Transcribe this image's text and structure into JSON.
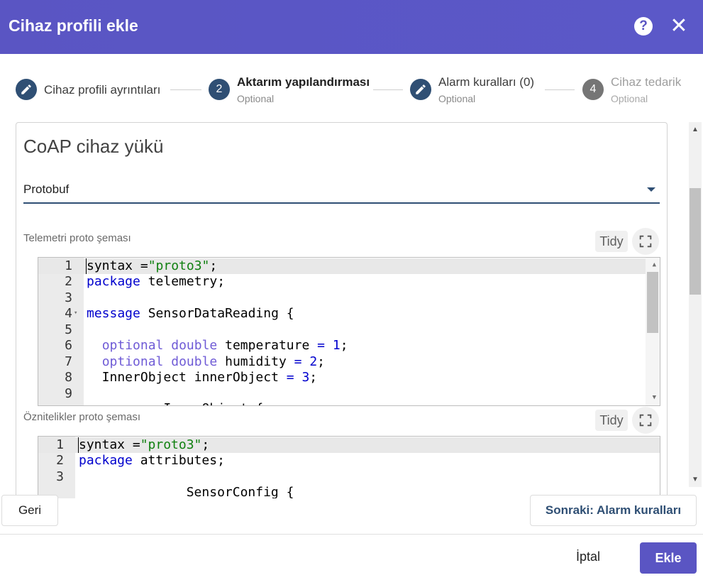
{
  "dialog": {
    "title": "Cihaz profili ekle",
    "help_icon": "?",
    "close_icon": "✕"
  },
  "stepper": {
    "steps": [
      {
        "index": "1",
        "icon": "pencil-icon",
        "label": "Cihaz profili ayrıntıları",
        "sub": "",
        "state": "edited"
      },
      {
        "index": "2",
        "icon": "",
        "label": "Aktarım yapılandırması",
        "sub": "Optional",
        "state": "active"
      },
      {
        "index": "3",
        "icon": "pencil-icon",
        "label": "Alarm kuralları (0)",
        "sub": "Optional",
        "state": "edited"
      },
      {
        "index": "4",
        "icon": "",
        "label": "Cihaz tedarik",
        "sub": "Optional",
        "state": "pending"
      }
    ]
  },
  "form": {
    "section_title": "CoAP cihaz yükü",
    "payload_type": "Protobuf",
    "telemetry": {
      "label": "Telemetri proto şeması",
      "tidy_label": "Tidy",
      "line_numbers": [
        "1",
        "2",
        "3",
        "4",
        "5",
        "6",
        "7",
        "8",
        "9"
      ]
    },
    "attributes": {
      "label": "Öznitelikler proto şeması",
      "tidy_label": "Tidy",
      "line_numbers": [
        "1",
        "2",
        "3"
      ]
    }
  },
  "footer": {
    "back_label": "Geri",
    "next_label": "Sonraki: Alarm kuralları",
    "cancel_label": "İptal",
    "add_label": "Ekle"
  },
  "colors": {
    "header": "#5a55c3",
    "primary": "#2f4f74",
    "keyword": "#0000cd",
    "type": "#6f5bd6",
    "string": "#108010"
  }
}
